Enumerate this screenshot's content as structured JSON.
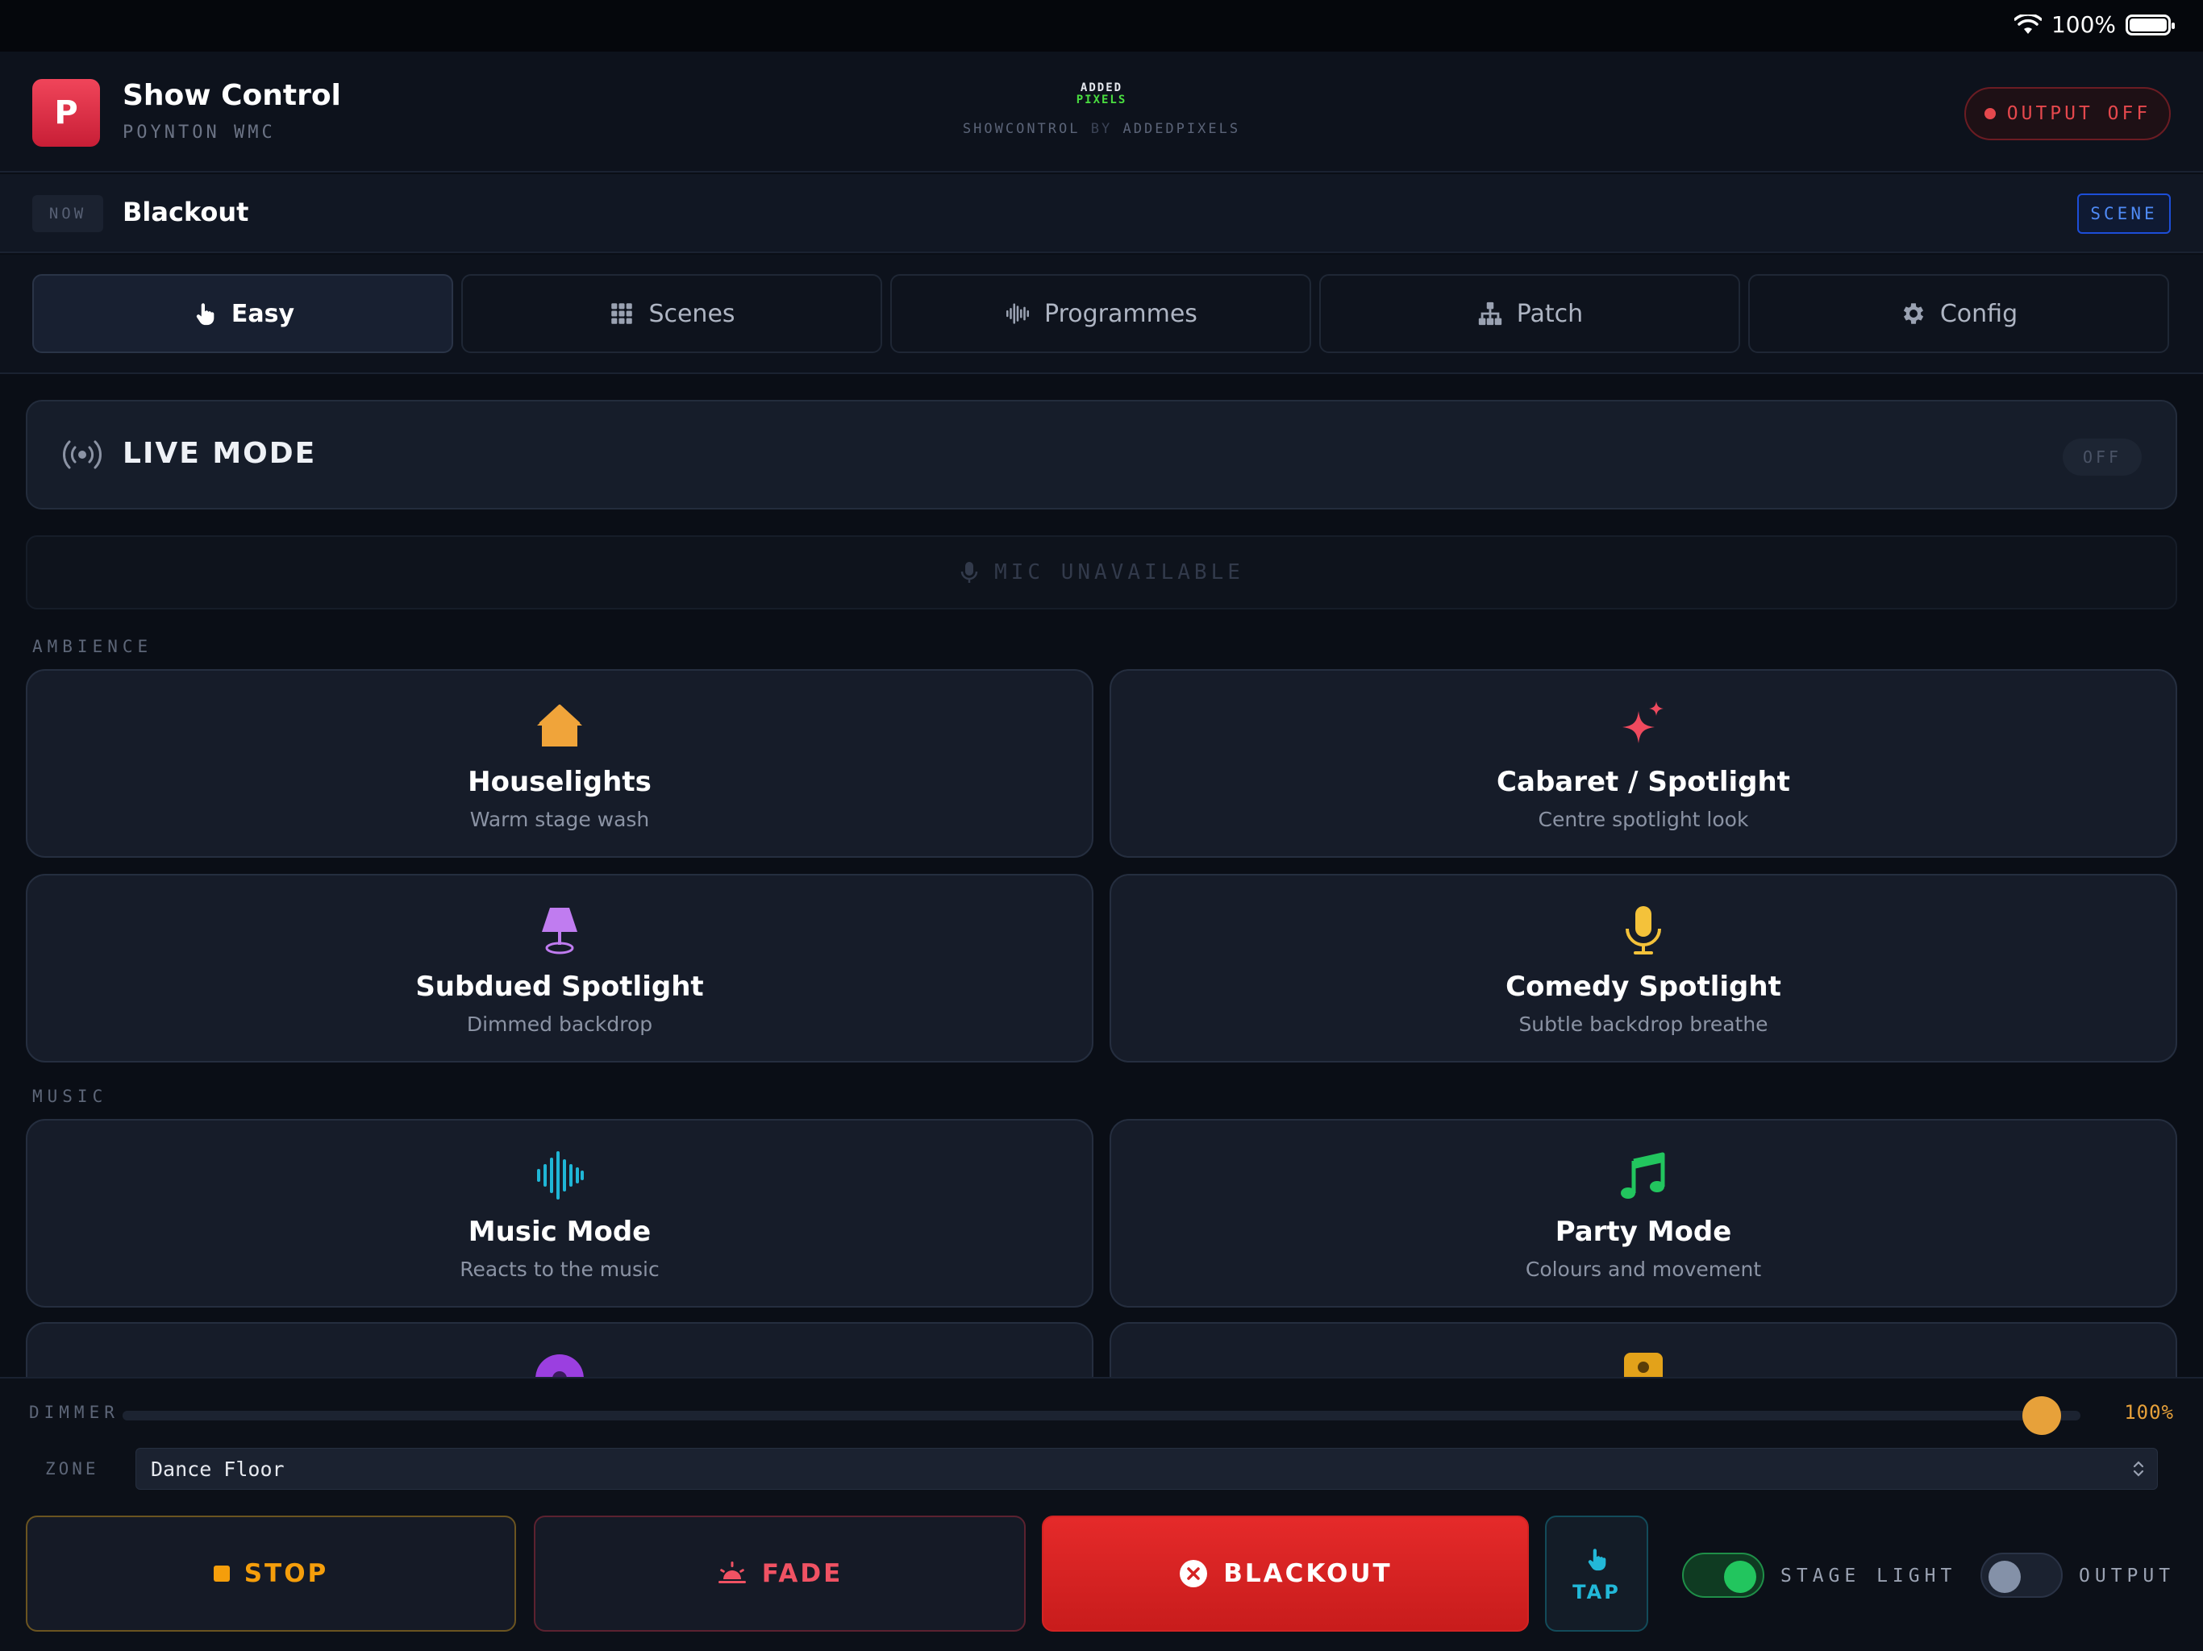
{
  "status_bar": {
    "battery": "100%"
  },
  "header": {
    "app_icon_letter": "P",
    "title": "Show Control",
    "subtitle": "POYNTON WMC",
    "brand_line1": "ADDED",
    "brand_line2": "PIXELS",
    "brand_tag_left": "SHOWCONTROL",
    "brand_tag_by": "BY",
    "brand_tag_right": "ADDEDPIXELS",
    "output_button": "OUTPUT OFF",
    "colors": {
      "accent_red": "#e5484d",
      "brand_green": "#4ade40"
    }
  },
  "now": {
    "tag": "NOW",
    "value": "Blackout",
    "badge": "SCENE"
  },
  "tabs": [
    {
      "label": "Easy",
      "icon": "hand-pointer-icon",
      "active": true
    },
    {
      "label": "Scenes",
      "icon": "grid-icon",
      "active": false
    },
    {
      "label": "Programmes",
      "icon": "waveform-icon",
      "active": false
    },
    {
      "label": "Patch",
      "icon": "network-icon",
      "active": false
    },
    {
      "label": "Config",
      "icon": "gear-icon",
      "active": false
    }
  ],
  "live_mode": {
    "label": "LIVE MODE",
    "state": "OFF",
    "icon": "broadcast-icon"
  },
  "mic": {
    "label": "MIC UNAVAILABLE",
    "icon": "microphone-icon"
  },
  "sections": {
    "ambience": {
      "label": "AMBIENCE",
      "cards": [
        {
          "title": "Houselights",
          "subtitle": "Warm stage wash",
          "icon": "house-icon",
          "color": "#f0a43a"
        },
        {
          "title": "Cabaret / Spotlight",
          "subtitle": "Centre spotlight look",
          "icon": "sparkles-icon",
          "color": "#ef4a5e"
        },
        {
          "title": "Subdued Spotlight",
          "subtitle": "Dimmed backdrop",
          "icon": "lamp-icon",
          "color": "#c07cf0"
        },
        {
          "title": "Comedy Spotlight",
          "subtitle": "Subtle backdrop breathe",
          "icon": "microphone-icon",
          "color": "#f4c23a"
        }
      ]
    },
    "music": {
      "label": "MUSIC",
      "cards": [
        {
          "title": "Music Mode",
          "subtitle": "Reacts to the music",
          "icon": "waveform-icon",
          "color": "#1fb6d6"
        },
        {
          "title": "Party Mode",
          "subtitle": "Colours and movement",
          "icon": "music-note-icon",
          "color": "#22c55e"
        }
      ]
    }
  },
  "dock": {
    "dimmer_label": "DIMMER",
    "dimmer_value": "100%",
    "dimmer_level": 1.0,
    "zone_label": "ZONE",
    "zone_value": "Dance Floor",
    "stop_label": "STOP",
    "fade_label": "FADE",
    "blackout_label": "BLACKOUT",
    "tap_label": "TAP",
    "stage_light_label": "STAGE LIGHT",
    "stage_light_on": true,
    "output_label": "OUTPUT",
    "output_on": false
  }
}
